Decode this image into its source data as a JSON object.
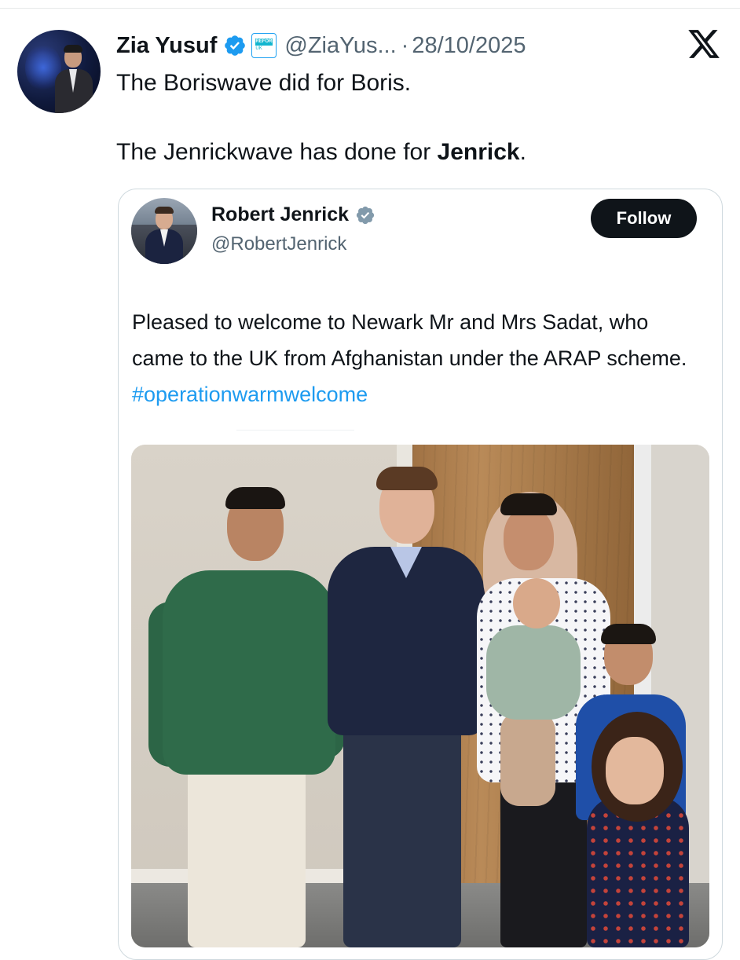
{
  "tweet": {
    "author_name": "Zia Yusuf",
    "badge_label": "REFORM",
    "badge_sub": "UK",
    "handle": "@ZiaYus...",
    "separator": "·",
    "date": "28/10/2025",
    "text_line1": "The Boriswave did for Boris.",
    "text_line2_prefix": "The Jenrickwave has done for ",
    "text_line2_bold": "Jenrick",
    "text_line2_suffix": "."
  },
  "quoted": {
    "author_name": "Robert Jenrick",
    "handle": "@RobertJenrick",
    "follow_label": "Follow",
    "text_main": "Pleased to welcome to Newark Mr and Mrs Sadat, who came to the UK from Afghanistan under the ARAP scheme. ",
    "hashtag": "#operationwarmwelcome"
  },
  "icons": {
    "verified": "verified-badge-icon",
    "platform": "x-logo-icon",
    "affiliation": "reform-uk-badge-icon"
  },
  "colors": {
    "verified_blue": "#1d9bf0",
    "verified_gray": "#829aab",
    "hashtag": "#1d9bf0",
    "follow_bg": "#0f1419",
    "secondary_text": "#536471"
  }
}
